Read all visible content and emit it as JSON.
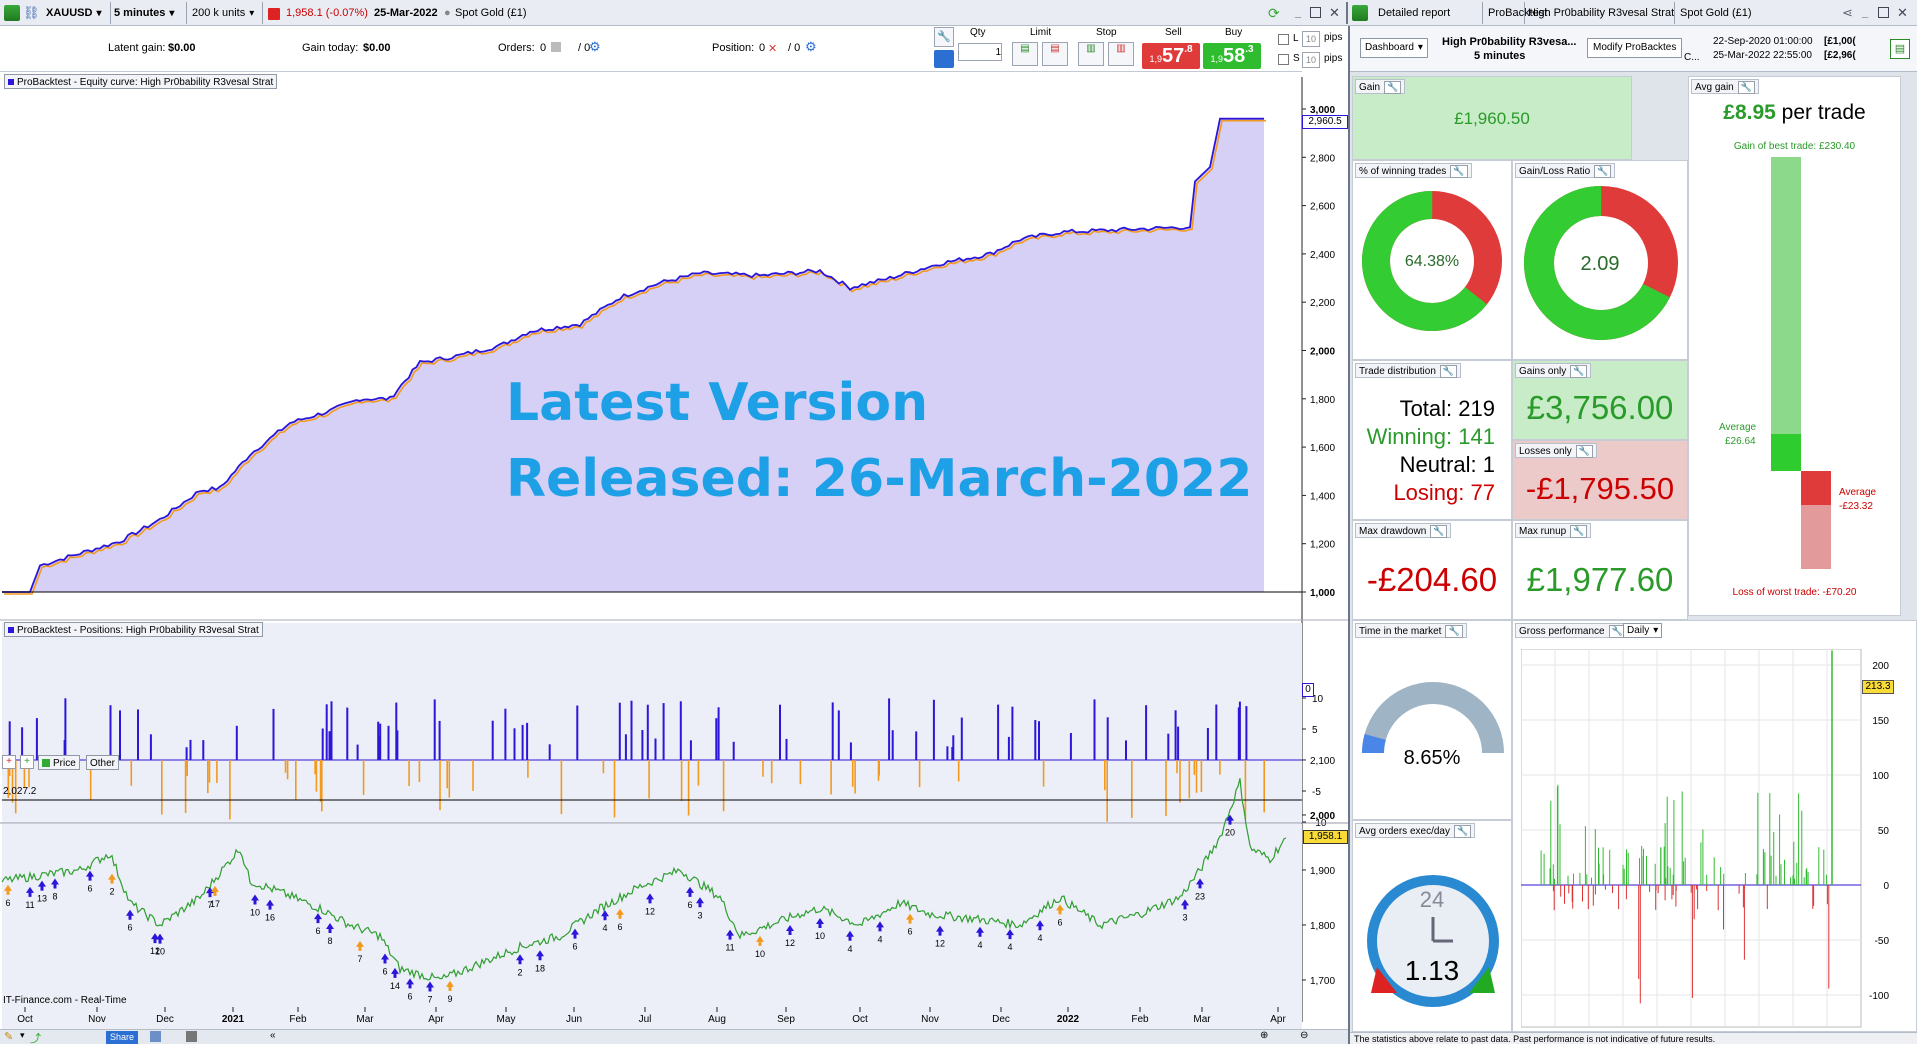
{
  "topbar": {
    "symbol": "XAUUSD",
    "timeframe": "5 minutes",
    "units": "200 k units",
    "price_change": "1,958.1 (-0.07%)",
    "date": "25-Mar-2022",
    "instrument": "Spot Gold (£1)",
    "detailed_report": "Detailed report",
    "probacktest": "ProBacktest",
    "strategy_tab": "High Pr0bability R3vesal Strat",
    "spot_gold": "Spot Gold (£1)"
  },
  "orderbar": {
    "latent_gain_label": "Latent gain:",
    "latent_gain": "$0.00",
    "gain_today_label": "Gain today:",
    "gain_today": "$0.00",
    "orders_label": "Orders:",
    "orders_a": "0",
    "orders_b": "/ 0",
    "position_label": "Position:",
    "position_a": "0",
    "position_b": "/ 0",
    "qty_label": "Qty",
    "qty_value": "1",
    "limit_label": "Limit",
    "stop_label": "Stop",
    "sell_label": "Sell",
    "buy_label": "Buy",
    "sell_small": "1,9",
    "sell_big": "57",
    "sell_sup": ".8",
    "buy_small": "1,9",
    "buy_big": "58",
    "buy_sup": ".3",
    "l_label": "L",
    "s_label": "S",
    "pips_value": "10",
    "pips_label": "pips"
  },
  "equity": {
    "title": "ProBacktest - Equity curve: High Pr0bability R3vesal Strat",
    "last_value": "2,960.5",
    "y_ticks": [
      "3,000",
      "2,800",
      "2,600",
      "2,400",
      "2,200",
      "2,000",
      "1,800",
      "1,600",
      "1,400",
      "1,200",
      "1,000"
    ],
    "overlay_line1": "Latest Version",
    "overlay_line2": "Released: 26-March-2022"
  },
  "positions": {
    "title": "ProBacktest - Positions: High Pr0bability R3vesal Strat",
    "y_ticks": [
      "10",
      "5",
      "0",
      "-5",
      "-10"
    ]
  },
  "price": {
    "tab_price": "Price",
    "tab_other": "Other",
    "ref_level": "2,027.2",
    "last_price": "1,958.1",
    "y_ticks": [
      "2,100",
      "2,000",
      "1,900",
      "1,800",
      "1,700"
    ],
    "source": "IT-Finance.com - Real-Time",
    "x_ticks": [
      "Oct",
      "Nov",
      "Dec",
      "2021",
      "Feb",
      "Mar",
      "Apr",
      "May",
      "Jun",
      "Jul",
      "Aug",
      "Sep",
      "Oct",
      "Nov",
      "Dec",
      "2022",
      "Feb",
      "Mar",
      "Apr"
    ],
    "markers": [
      "6",
      "11",
      "8",
      "13",
      "6",
      "2",
      "6",
      "12",
      "10",
      "7",
      "17",
      "10",
      "16",
      "6",
      "8",
      "7",
      "6",
      "14",
      "6",
      "7",
      "9",
      "2",
      "18",
      "6",
      "4",
      "6",
      "12",
      "6",
      "3",
      "11",
      "10",
      "12",
      "10",
      "4",
      "4",
      "6",
      "12",
      "4",
      "4",
      "4",
      "6",
      "3",
      "23",
      "20"
    ]
  },
  "report": {
    "dashboard_label": "Dashboard",
    "strategy_name": "High Pr0bability R3vesa...",
    "strategy_tf": "5 minutes",
    "modify_label": "Modify ProBacktes",
    "period_c1": "C...",
    "from_date": "22-Sep-2020 01:00:00",
    "from_value": "[£1,00(",
    "to_date": "25-Mar-2022 22:55:00",
    "to_value": "[£2,96("
  },
  "stats": {
    "gain_label": "Gain",
    "gain_value": "£1,960.50",
    "avg_gain_label": "Avg gain",
    "avg_gain_value": "£8.95",
    "avg_gain_suffix": "per trade",
    "best_trade_label": "Gain of best trade: £230.40",
    "avg_pos_label": "Average",
    "avg_pos_value": "£26.64",
    "avg_neg_label": "Average",
    "avg_neg_value": "-£23.32",
    "worst_trade_label": "Loss of worst trade: -£70.20",
    "winning_pct_label": "% of winning trades",
    "winning_pct_value": "64.38%",
    "winning_pct": 64.38,
    "gl_ratio_label": "Gain/Loss Ratio",
    "gl_ratio_value": "2.09",
    "gl_ratio": 2.09,
    "trade_dist_label": "Trade distribution",
    "total_label": "Total:",
    "total": "219",
    "winning_label": "Winning:",
    "winning": "141",
    "neutral_label": "Neutral:",
    "neutral": "1",
    "losing_label": "Losing:",
    "losing": "77",
    "gains_only_label": "Gains only",
    "gains_only_value": "£3,756.00",
    "losses_only_label": "Losses only",
    "losses_only_value": "-£1,795.50",
    "max_dd_label": "Max drawdown",
    "max_dd_value": "-£204.60",
    "max_runup_label": "Max runup",
    "max_runup_value": "£1,977.60",
    "time_market_label": "Time in the market",
    "time_market_value": "8.65%",
    "time_market_pct": 8.65,
    "gross_perf_label": "Gross performance",
    "gross_perf_mode": "Daily",
    "gross_y_ticks": [
      "200",
      "150",
      "100",
      "50",
      "0",
      "-50",
      "-100"
    ],
    "gross_last": "213.3",
    "avg_orders_label": "Avg orders exec/day",
    "avg_orders_value": "1.13",
    "clock_label": "24",
    "footer_note": "The statistics above relate to past data. Past performance is not indicative of future results."
  },
  "toolbar_bottom": {
    "share_label": "Share"
  },
  "colors": {
    "equity_line": "#2b16d9",
    "equity_fill": "#d6d0f7",
    "orange": "#f39a1e",
    "green": "#33cc33",
    "red": "#dd3333",
    "overlay_text": "#1ea0e6",
    "sell_bg": "#e03b3b",
    "buy_bg": "#2fbd2f"
  }
}
